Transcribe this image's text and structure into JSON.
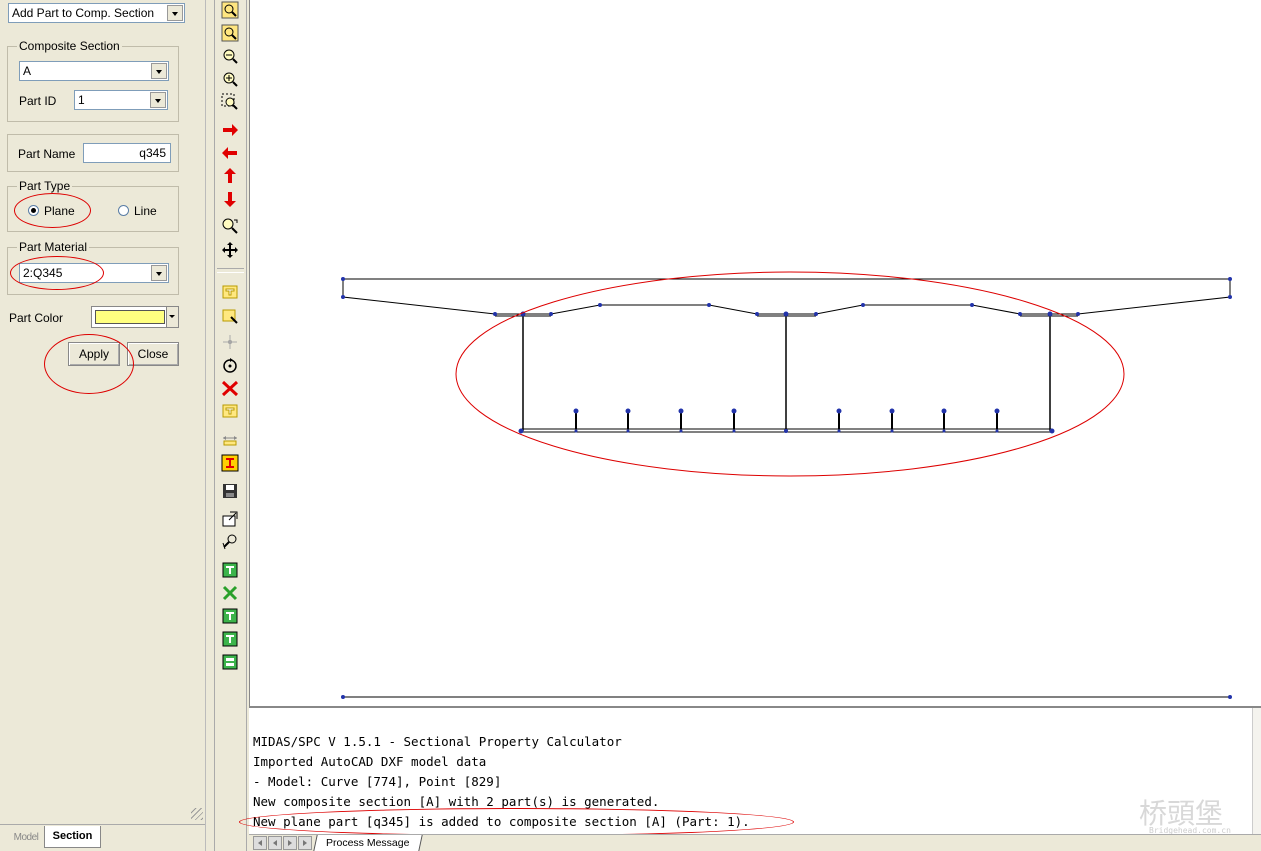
{
  "panel": {
    "mode_select": "Add Part to Comp. Section",
    "composite_section": {
      "legend": "Composite Section",
      "section_value": "A",
      "part_id_label": "Part ID",
      "part_id_value": "1"
    },
    "part_name": {
      "label": "Part Name",
      "value": "q345"
    },
    "part_type": {
      "legend": "Part Type",
      "plane_label": "Plane",
      "line_label": "Line",
      "selected": "Plane"
    },
    "part_material": {
      "legend": "Part Material",
      "value": "2:Q345"
    },
    "part_color": {
      "label": "Part Color",
      "swatch": "#ffff80"
    },
    "apply_label": "Apply",
    "close_label": "Close",
    "bottom_tabs": [
      "Model",
      "Section"
    ]
  },
  "messages": [
    "MIDAS/SPC V 1.5.1 - Sectional Property Calculator",
    "Imported AutoCAD DXF model data",
    "- Model: Curve [774], Point [829]",
    "New composite section [A] with 2 part(s) is generated.",
    "New plane part [q345] is added to composite section [A] (Part: 1)."
  ],
  "message_tab": "Process Message",
  "watermark": {
    "cn": "桥頭堡",
    "en": "Bridgehead.com.cn"
  },
  "colors": {
    "annotation": "#dd0000",
    "section_line": "#000000",
    "node": "#2233aa",
    "swatch": "#ffff80"
  }
}
